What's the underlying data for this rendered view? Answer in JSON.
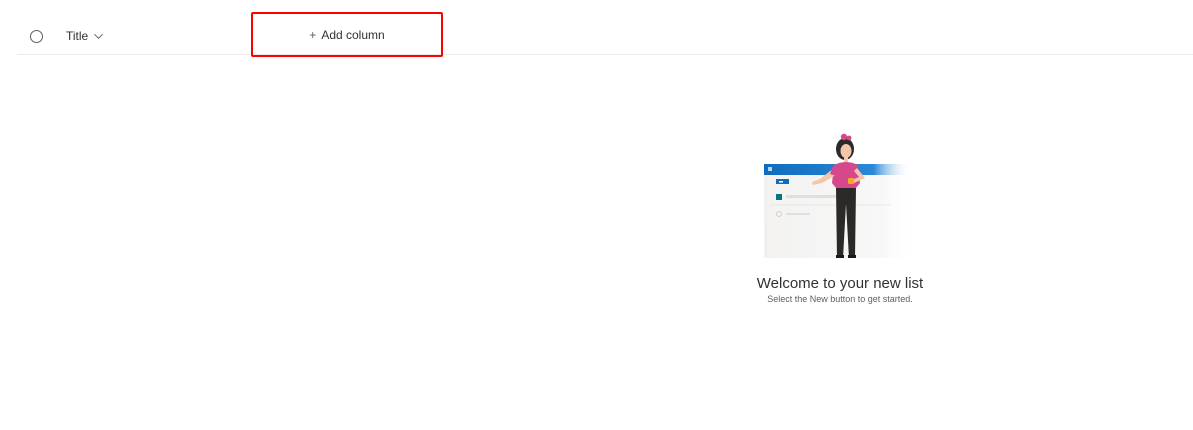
{
  "list_header": {
    "select_all_label": "",
    "title_column_label": "Title",
    "add_column_label": "Add column",
    "add_column_icon": "plus-icon",
    "title_sort_icon": "chevron-down-icon"
  },
  "empty_state": {
    "heading": "Welcome to your new list",
    "subtext": "Select the New button to get started.",
    "illustration": "woman-presenting-list-illustration"
  },
  "colors": {
    "highlight_border": "#ff0000",
    "accent_blue": "#0f6cbd",
    "shirt_pink": "#d6478b",
    "teal_square": "#03787c"
  }
}
